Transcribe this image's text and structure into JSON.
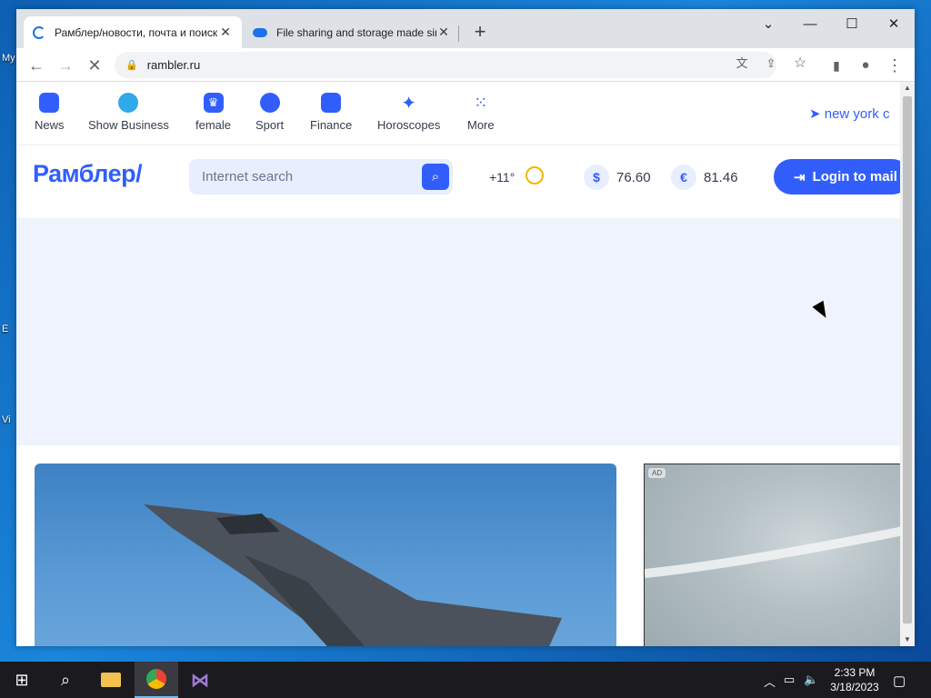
{
  "desktop": {
    "icon_labels": [
      "My",
      "E",
      "Vi"
    ]
  },
  "browser": {
    "tabs": [
      {
        "title": "Рамблер/новости, почта и поиск",
        "active": true
      },
      {
        "title": "File sharing and storage made simple",
        "active": false
      }
    ],
    "new_tab_label": "+",
    "url": "rambler.ru",
    "controls": {
      "minimize": "—",
      "maximize": "☐",
      "close": "✕",
      "tab_search": "⌄"
    }
  },
  "site": {
    "nav": [
      {
        "label": "News",
        "icon": "news-icon",
        "color": "#315efb"
      },
      {
        "label": "Show Business",
        "icon": "microphone-icon",
        "color": "#2fa9e8"
      },
      {
        "label": "female",
        "icon": "crown-icon",
        "color": "#315efb"
      },
      {
        "label": "Sport",
        "icon": "ball-icon",
        "color": "#315efb"
      },
      {
        "label": "Finance",
        "icon": "wallet-icon",
        "color": "#315efb"
      },
      {
        "label": "Horoscopes",
        "icon": "star-icon",
        "color": "#315efb"
      },
      {
        "label": "More",
        "icon": "grid-icon",
        "color": "#315efb"
      }
    ],
    "location": "new york c",
    "logo": "Рамблер/",
    "search_placeholder": "Internet search",
    "weather": "+11°",
    "rates": [
      {
        "symbol": "$",
        "value": "76.60"
      },
      {
        "symbol": "€",
        "value": "81.46"
      }
    ],
    "login_label": "Login to mail",
    "ad_badge": "AD"
  },
  "taskbar": {
    "time": "2:33 PM",
    "date": "3/18/2023"
  }
}
